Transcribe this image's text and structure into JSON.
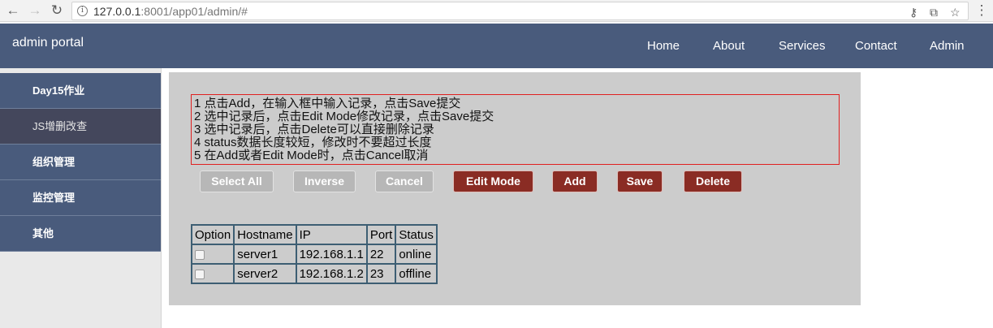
{
  "browser": {
    "url_host": "127.0.0.1",
    "url_rest": ":8001/app01/admin/#",
    "back_icon": "back-arrow-icon",
    "forward_icon": "forward-arrow-icon",
    "reload_icon": "reload-icon",
    "back_glyph": "←",
    "forward_glyph": "→",
    "reload_glyph": "↻",
    "info_glyph": "i",
    "key_glyph": "⚷",
    "translate_glyph": "⧉",
    "star_glyph": "☆",
    "menu_glyph": "⋮"
  },
  "navbar": {
    "brand": "admin portal",
    "links": [
      "Home",
      "About",
      "Services",
      "Contact",
      "Admin"
    ],
    "bg_color": "#495b7c"
  },
  "sidebar": {
    "items": [
      {
        "label": "Day15作业"
      },
      {
        "label": "JS增删改查"
      },
      {
        "label": "组织管理"
      },
      {
        "label": "监控管理"
      },
      {
        "label": "其他"
      }
    ],
    "active_index": 1
  },
  "instructions": [
    "1 点击Add，在输入框中输入记录，点击Save提交",
    "2 选中记录后，点击Edit Mode修改记录，点击Save提交",
    "3 选中记录后，点击Delete可以直接删除记录",
    "4 status数据长度较短，修改时不要超过长度",
    "5 在Add或者Edit Mode时，点击Cancel取消"
  ],
  "buttons": {
    "select_all": "Select All",
    "inverse": "Inverse",
    "cancel": "Cancel",
    "edit_mode": "Edit Mode",
    "add": "Add",
    "save": "Save",
    "delete": "Delete",
    "red_color": "#8a2c24",
    "grey_color": "#b7b7b7"
  },
  "table": {
    "headers": [
      "Option",
      "Hostname",
      "IP",
      "Port",
      "Status"
    ],
    "rows": [
      {
        "hostname": "server1",
        "ip": "192.168.1.1",
        "port": "22",
        "status": "online"
      },
      {
        "hostname": "server2",
        "ip": "192.168.1.2",
        "port": "23",
        "status": "offline"
      }
    ]
  }
}
